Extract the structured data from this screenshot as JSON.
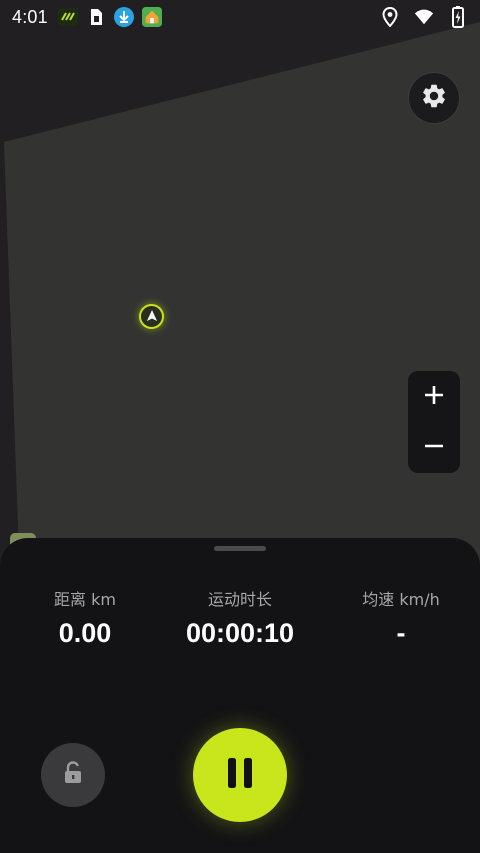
{
  "status_bar": {
    "time": "4:01",
    "left_icons": [
      "app-notification-icon",
      "sim-card-icon",
      "download-icon",
      "home-app-icon"
    ],
    "right_icons": [
      "location-icon",
      "wifi-icon",
      "battery-charging-icon"
    ]
  },
  "map": {
    "area_color": "#333431",
    "background_color": "#221f22",
    "marker_color": "#c8e21a"
  },
  "controls": {
    "settings_icon": "gear-icon",
    "zoom_in_symbol": "+",
    "zoom_out_symbol": "−"
  },
  "workout": {
    "distance_label": "距离 km",
    "distance_value": "0.00",
    "duration_label": "运动时长",
    "duration_value": "00:00:10",
    "speed_label": "均速 km/h",
    "speed_value": "-"
  },
  "actions": {
    "lock_icon": "unlock-icon",
    "pause_icon": "pause-icon",
    "accent_color": "#c8e61b"
  }
}
